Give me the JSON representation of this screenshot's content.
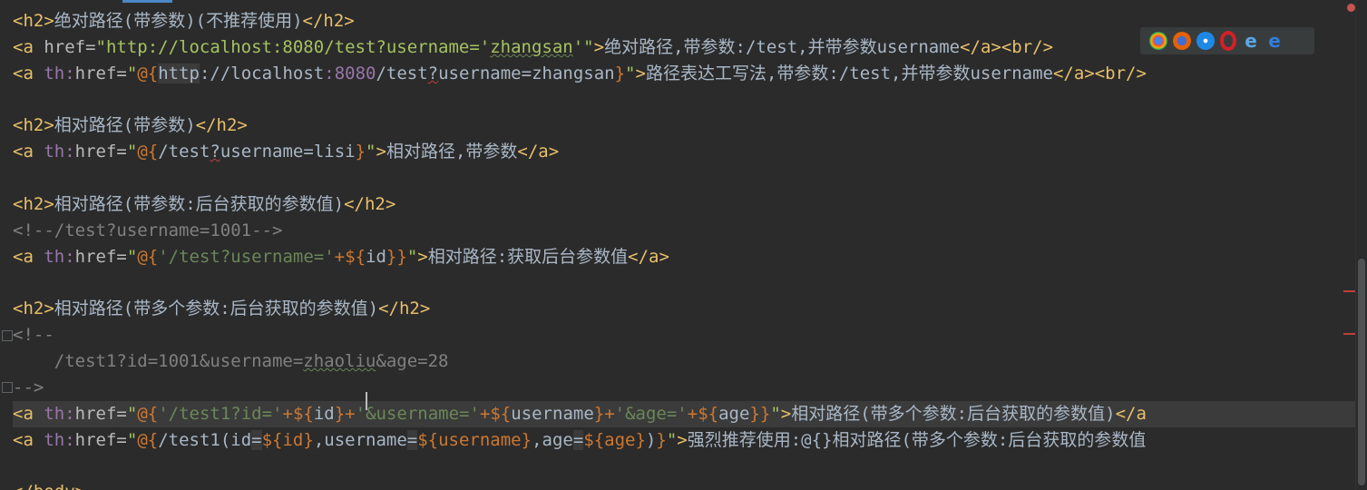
{
  "editor": {
    "lines": {
      "l1": {
        "open": "<h2>",
        "text": "绝对路径(带参数)(不推荐使用)",
        "close": "</h2>"
      },
      "l2": {
        "a": "<a ",
        "attr": "href=",
        "q1": "\"http://localhost:8080/test?username='",
        "user": "zhangsan",
        "q2": "'\"",
        "gt": ">",
        "text": "绝对路径,带参数:/test,并带参数username",
        "close": "</a><br/>"
      },
      "l3": {
        "a": "<a ",
        "ns": "th:",
        "attr": "href=",
        "q1": "\"",
        "expr": "@{",
        "p1": "http",
        "p2": "://localhost",
        "p3": ":8080",
        "p4": "/test",
        "p5": "?",
        "p6": "username",
        "p7": "=zhangsan",
        "exprend": "}",
        "q2": "\"",
        "gt": ">",
        "text": "路径表达工写法,带参数:/test,并带参数username",
        "close": "</a><br/>"
      },
      "l5": {
        "open": "<h2>",
        "text": "相对路径(带参数)",
        "close": "</h2>"
      },
      "l6": {
        "a": "<a ",
        "ns": "th:",
        "attr": "href=",
        "q1": "\"",
        "expr": "@{",
        "p1": "/test",
        "p2": "?",
        "p3": "username",
        "p4": "=lisi",
        "exprend": "}",
        "q2": "\"",
        "gt": ">",
        "text": "相对路径,带参数",
        "close": "</a>"
      },
      "l8": {
        "open": "<h2>",
        "text": "相对路径(带参数:后台获取的参数值)",
        "close": "</h2>"
      },
      "l9": {
        "comment": "<!--/test?username=1001-->"
      },
      "l10": {
        "a": "<a ",
        "ns": "th:",
        "attr": "href=",
        "q1": "\"",
        "expr": "@{",
        "s1": "'/test?username='",
        "plus": "+",
        "v1": "${",
        "v2": "id",
        "v3": "}",
        "exprend": "}",
        "q2": "\"",
        "gt": ">",
        "text": "相对路径:获取后台参数值",
        "close": "</a>"
      },
      "l12": {
        "open": "<h2>",
        "text": "相对路径(带多个参数:后台获取的参数值)",
        "close": "</h2>"
      },
      "l13": {
        "comment": "<!--"
      },
      "l14": {
        "pre": "    /test1?id=1001&username=",
        "user": "zhaoliu",
        "post": "&age=28"
      },
      "l15": {
        "comment": "-->"
      },
      "l16": {
        "a": "<a ",
        "ns": "th:",
        "attr": "href=",
        "q1": "\"",
        "expr": "@{",
        "s1": "'/test1?id='",
        "plus1": "+",
        "v1a": "${",
        "v1b": "id",
        "v1c": "}",
        "plus2": "+",
        "s2": "'&username='",
        "plus3": "+",
        "v2a": "${",
        "v2b": "username",
        "v2c": "}",
        "plus4": "+",
        "s3": "'&age='",
        "plus5": "+",
        "v3a": "${",
        "v3b": "age",
        "v3c": "}",
        "exprend": "}",
        "q2": "\"",
        "gt": ">",
        "text": "相对路径(带多个参数:后台获取的参数值)",
        "close": "</a"
      },
      "l17": {
        "a": "<a ",
        "ns": "th:",
        "attr": "href=",
        "q1": "\"",
        "expr": "@{",
        "p1": "/test1(id",
        "eq1": "=",
        "v1": "${id}",
        "c1": ",username",
        "eq2": "=",
        "v2": "${username}",
        "c2": ",age",
        "eq3": "=",
        "v3": "${age}",
        "p2": ")",
        "exprend": "}",
        "q2": "\"",
        "gt": ">",
        "text": "强烈推荐使用:@{}相对路径(带多个参数:后台获取的参数值"
      },
      "l19": {
        "text": "</body>"
      }
    },
    "browser_icons": [
      "chrome-icon",
      "firefox-icon",
      "safari-icon",
      "opera-icon",
      "ie-icon",
      "edge-icon"
    ],
    "colors": {
      "background": "#2b2b2b",
      "tag": "#e8bf6a",
      "string": "#6a8759",
      "expression": "#cc7832",
      "variable": "#ffc66d",
      "comment": "#808080",
      "error": "#bc3f3c"
    }
  }
}
